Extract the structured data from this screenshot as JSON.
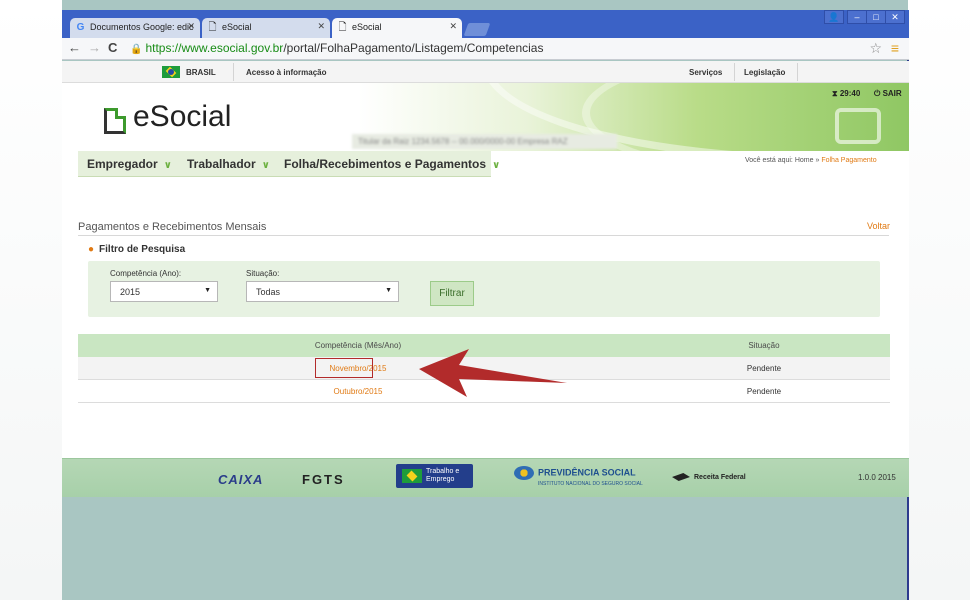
{
  "browser": {
    "tabs": [
      {
        "label": "Documentos Google: edic",
        "icon": "google-icon"
      },
      {
        "label": "eSocial",
        "icon": "page-icon"
      },
      {
        "label": "eSocial",
        "icon": "page-icon",
        "active": true
      }
    ],
    "url_scheme": "https://",
    "url_host": "www.esocial.gov.br",
    "url_path": "/portal/FolhaPagamento/Listagem/Competencias"
  },
  "gov_bar": {
    "country": "BRASIL",
    "access": "Acesso à informação",
    "services": "Serviços",
    "legislation": "Legislação"
  },
  "header": {
    "logo": "eSocial",
    "timer": "29:40",
    "logout": "SAIR",
    "employer_blurred": "Titular da Raiz 1234.5678 -- 00.000/0000-00 Empresa RAZ"
  },
  "menu": [
    {
      "label": "Empregador"
    },
    {
      "label": "Trabalhador"
    },
    {
      "label": "Folha/Recebimentos e Pagamentos"
    }
  ],
  "breadcrumb": {
    "prefix": "Você está aqui:",
    "home": "Home",
    "separator": "»",
    "current": "Folha Pagamento"
  },
  "page": {
    "title": "Pagamentos e Recebimentos Mensais",
    "back": "Voltar"
  },
  "filter": {
    "title": "Filtro de Pesquisa",
    "year_label": "Competência (Ano):",
    "year_value": "2015",
    "status_label": "Situação:",
    "status_value": "Todas",
    "button": "Filtrar"
  },
  "table": {
    "headers": [
      "Competência (Mês/Ano)",
      "Situação"
    ],
    "rows": [
      {
        "period": "Novembro/2015",
        "status": "Pendente"
      },
      {
        "period": "Outubro/2015",
        "status": "Pendente"
      }
    ]
  },
  "footer": {
    "caixa": "CAIXA",
    "fgts": "FGTS",
    "mte": "Ministério do Trabalho e Emprego",
    "mte_short1": "Trabalho e",
    "mte_short2": "Emprego",
    "previdencia": "PREVIDÊNCIA SOCIAL",
    "previdencia_sub": "INSTITUTO NACIONAL DO SEGURO SOCIAL",
    "receita": "Receita Federal",
    "version": "1.0.0 2015"
  },
  "colors": {
    "accent_orange": "#e07a14",
    "green_light": "#c9e6c2",
    "annotation_red": "#b22b2b"
  }
}
